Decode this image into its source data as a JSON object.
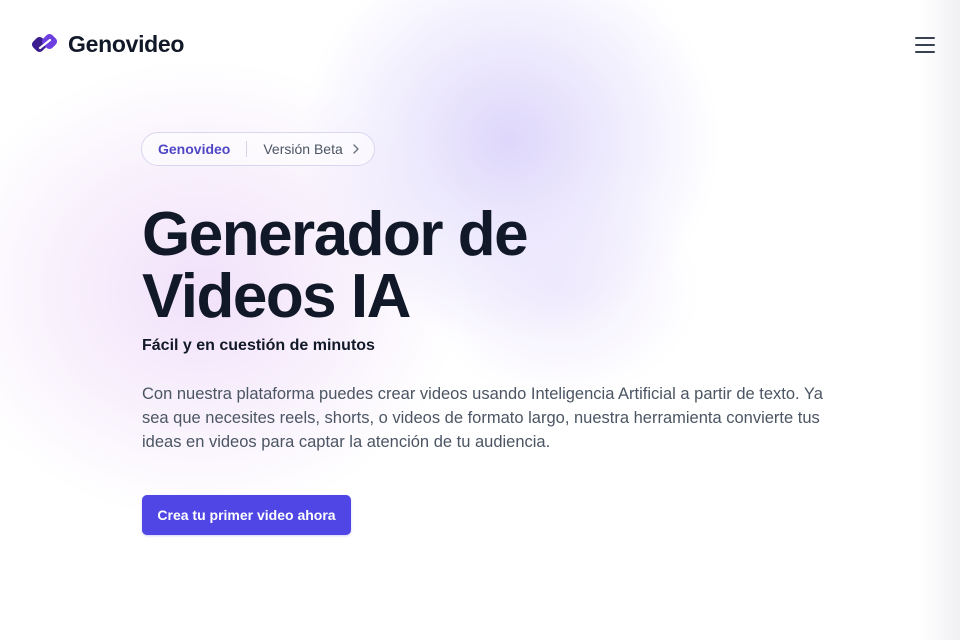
{
  "header": {
    "brand": "Genovideo",
    "logo_icon": "genovideo-logo-icon",
    "menu_icon": "hamburger-menu-icon"
  },
  "badge": {
    "brand": "Genovideo",
    "label": "Versión Beta",
    "chevron_icon": "chevron-right-icon"
  },
  "hero": {
    "title_line1": "Generador de",
    "title_line2": "Videos IA",
    "subtitle": "Fácil y en cuestión de minutos",
    "description": "Con nuestra plataforma puedes crear videos usando Inteligencia Artificial a partir de texto. Ya sea que necesites reels, shorts, o videos de formato largo, nuestra herramienta convierte tus ideas en videos para captar la atención de tu audiencia.",
    "cta_label": "Crea tu primer video ahora"
  },
  "colors": {
    "accent": "#4f46e5",
    "badge_brand": "#4f46c5",
    "title": "#111827",
    "body_text": "#4b5563",
    "logo_dark": "#3b1d8f",
    "logo_light": "#8b5cf6"
  }
}
